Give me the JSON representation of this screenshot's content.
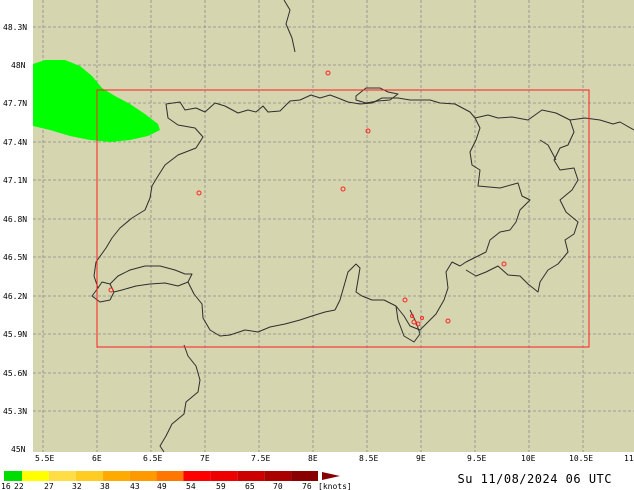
{
  "map": {
    "lat_labels": [
      "48.3N",
      "48N",
      "47.7N",
      "47.4N",
      "47.1N",
      "46.8N",
      "46.5N",
      "46.2N",
      "45.9N",
      "45.6N",
      "45.3N",
      "45N"
    ],
    "lon_labels": [
      "5.5E",
      "6E",
      "6.5E",
      "7E",
      "7.5E",
      "8E",
      "8.5E",
      "9E",
      "9.5E",
      "10E",
      "10.5E",
      "11"
    ],
    "colors": {
      "land": "#d5d5b0",
      "border": "#2e2e2e",
      "grid": "#8c8c8c",
      "box": "#ff2020",
      "station": "#ff2020",
      "wind_area": "#00ff00"
    },
    "station_count": 12,
    "wind_area_speed_band": "16 22"
  },
  "legend": {
    "values": [
      "16",
      "22",
      "27",
      "32",
      "38",
      "43",
      "49",
      "54",
      "59",
      "65",
      "70",
      "76"
    ],
    "unit": "[knots]",
    "colors": [
      "#00dd00",
      "#ffff00",
      "#ffdd44",
      "#ffcc22",
      "#ffaa00",
      "#ff9900",
      "#ff7700",
      "#ff0000",
      "#ee0000",
      "#cc0000",
      "#aa0000",
      "#880000"
    ]
  },
  "footer": {
    "timestamp": "Su 11/08/2024 06 UTC"
  }
}
